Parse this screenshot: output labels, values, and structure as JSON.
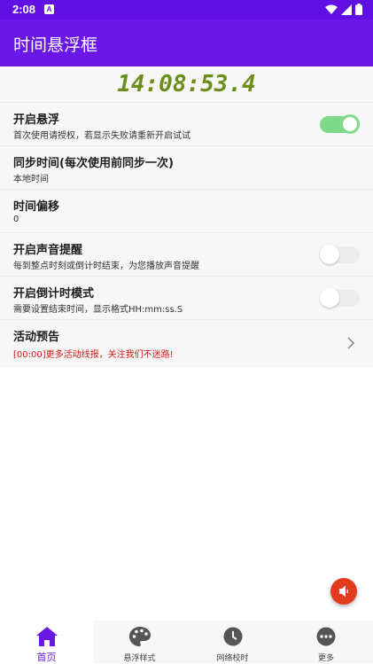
{
  "status_bar": {
    "time": "2:08",
    "notification_badge": "A"
  },
  "app_bar": {
    "title": "时间悬浮框"
  },
  "clock": {
    "display": "14:08:53.4"
  },
  "settings": [
    {
      "title": "开启悬浮",
      "subtitle": "首次使用请授权，若显示失败请重新开启试试",
      "control": "toggle",
      "enabled": true
    },
    {
      "title": "同步时间(每次使用前同步一次)",
      "subtitle": "本地时间",
      "control": "none"
    },
    {
      "title": "时间偏移",
      "subtitle": "0",
      "control": "none"
    },
    {
      "title": "开启声音提醒",
      "subtitle": "每到整点时刻或倒计时结束，为您播放声音提醒",
      "control": "toggle",
      "enabled": false
    },
    {
      "title": "开启倒计时模式",
      "subtitle": "需要设置结束时间，显示格式HH:mm:ss.S",
      "control": "toggle",
      "enabled": false
    },
    {
      "title": "活动预告",
      "subtitle": "[00:00]更多活动线报，关注我们不迷路!",
      "control": "chevron",
      "subtitle_color": "#d21a1a"
    }
  ],
  "bottom_nav": [
    {
      "label": "首页",
      "icon": "home-icon",
      "active": true
    },
    {
      "label": "悬浮样式",
      "icon": "palette-icon",
      "active": false
    },
    {
      "label": "网络校时",
      "icon": "clock-icon",
      "active": false
    },
    {
      "label": "更多",
      "icon": "more-icon",
      "active": false
    }
  ],
  "colors": {
    "primary": "#6a17e8",
    "status_bar": "#6110e3",
    "clock_digits": "#6b8e1a",
    "toggle_on": "#7ed98a",
    "fab": "#e13b1f",
    "notice_red": "#d21a1a"
  }
}
